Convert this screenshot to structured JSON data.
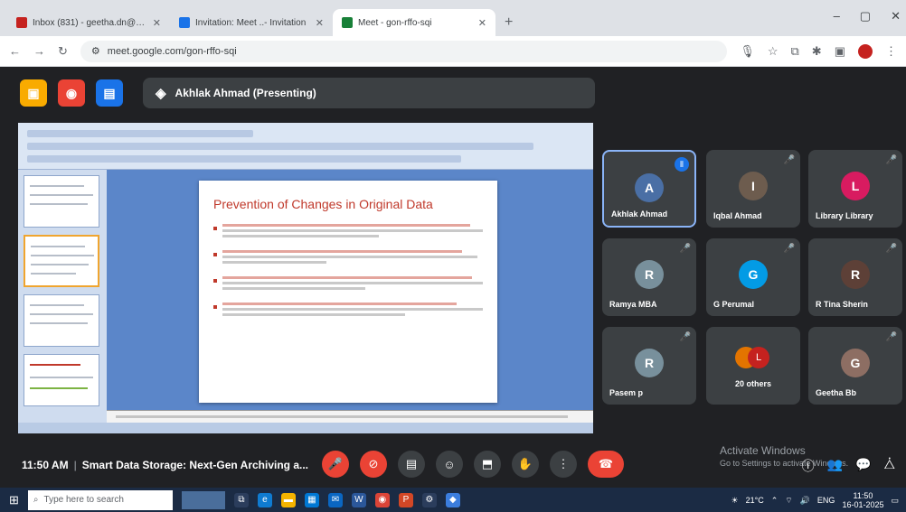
{
  "browser": {
    "tabs": [
      {
        "title": "Inbox (831) - geetha.dn@ant...",
        "color": "#c5221f"
      },
      {
        "title": "Invitation: Meet ..- Invitation",
        "color": "#1a73e8"
      },
      {
        "title": "Meet - gon-rffo-sqi",
        "color": "#188038"
      }
    ],
    "new_tab": "+",
    "url": "meet.google.com/gon-rffo-sqi",
    "window_controls": {
      "minimize": "–",
      "maximize": "▢",
      "close": "✕"
    }
  },
  "meet": {
    "presenter_label": "Akhlak Ahmad (Presenting)",
    "slide": {
      "title": "Prevention of Changes in Original Data"
    },
    "participants": [
      {
        "name": "Akhlak Ahmad",
        "initial": "A",
        "avatar_color": "#4a6fa5",
        "speaking": true
      },
      {
        "name": "Iqbal Ahmad",
        "initial": "I",
        "avatar_color": "#6d5c4e",
        "speaking": false
      },
      {
        "name": "Library Library",
        "initial": "L",
        "avatar_color": "#d81b60",
        "speaking": false
      },
      {
        "name": "Ramya MBA",
        "initial": "R",
        "avatar_color": "#78909c",
        "speaking": false
      },
      {
        "name": "G Perumal",
        "initial": "G",
        "avatar_color": "#039be5",
        "speaking": false
      },
      {
        "name": "R Tina Sherin",
        "initial": "R",
        "avatar_color": "#5d4037",
        "speaking": false
      },
      {
        "name": "Pasem p",
        "initial": "R",
        "avatar_color": "#78909c",
        "speaking": false
      },
      {
        "name": "20 others",
        "initial": "",
        "avatar_color": "#e37400",
        "speaking": false
      },
      {
        "name": "Geetha Bb",
        "initial": "G",
        "avatar_color": "#8d6e63",
        "speaking": false
      }
    ],
    "meeting_time": "11:50 AM",
    "meeting_title": "Smart Data Storage: Next-Gen Archiving a...",
    "activate_windows": {
      "line1": "Activate Windows",
      "line2": "Go to Settings to activate Windows."
    }
  },
  "taskbar": {
    "search_placeholder": "Type here to search",
    "weather": "21°C",
    "time": "11:50",
    "date": "16-01-2025"
  }
}
